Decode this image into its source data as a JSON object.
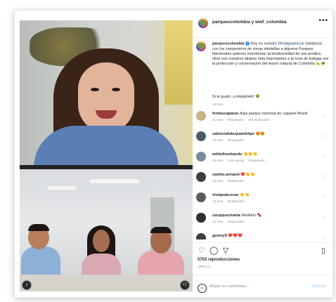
{
  "header": {
    "account_names": "parquescolombia y wwf_colombia",
    "more_label": "•••"
  },
  "caption": {
    "username": "parquescolombia",
    "text_before_tag": "Hoy en nuestro ",
    "tag": "#InstagramLive",
    "text_after_tag": " hablamos con los campesinos de zonas aledañas a algunos Parques Nacionales quienes monitorean la biodiversidad de sus predios, ellos son nuestros aliados más importantes a la hora de trabajar por la protección y conservación del tesoro natural de Colombia 🐆🐢",
    "follow_up": "Si te gustó, ¡compártelo! 🌳",
    "time": "13 sem"
  },
  "comments": [
    {
      "user": "freitascaparao",
      "text": "Aqui parque nacional do caparaó Brasil",
      "time": "11 sem",
      "reply": "Responder",
      "extra": "Ver traducción",
      "avatar_color": "#c9b48a"
    },
    {
      "user": "valenciahdezjuanfelipe",
      "text": "😍😍",
      "time": "13 sem",
      "reply": "Responder",
      "extra": "",
      "avatar_color": "#4d5a66"
    },
    {
      "user": "militelloeduardo",
      "text": "👏👏👏",
      "time": "13 sem",
      "reply": "Responder",
      "extra": "1 Me gusta",
      "avatar_color": "#7a8a9a"
    },
    {
      "user": "camilo.armand",
      "text": "❤️👏👏",
      "time": "13 sem",
      "reply": "Responder",
      "extra": "",
      "avatar_color": "#3d3d3d"
    },
    {
      "user": "elviajedecesar",
      "text": "👏👏",
      "time": "13 sem",
      "reply": "Responder",
      "extra": "",
      "avatar_color": "#5c5c5c"
    },
    {
      "user": "cacqquezirama",
      "text": "Medellín 🍫",
      "time": "13 sem",
      "reply": "Responder",
      "extra": "",
      "avatar_color": "#2e2e2e"
    },
    {
      "user": "gemny9",
      "text": "❤️❤️❤️",
      "time": "13 sem",
      "reply": "Responder",
      "extra": "",
      "avatar_color": "#3f3f3f"
    }
  ],
  "heart_icon_glyph": "♡",
  "actions": {
    "views": "5703 reproducciones",
    "date": "ABRIL 11"
  },
  "add_comment": {
    "placeholder": "Añade un comentario...",
    "publish_label": "Publicar"
  }
}
